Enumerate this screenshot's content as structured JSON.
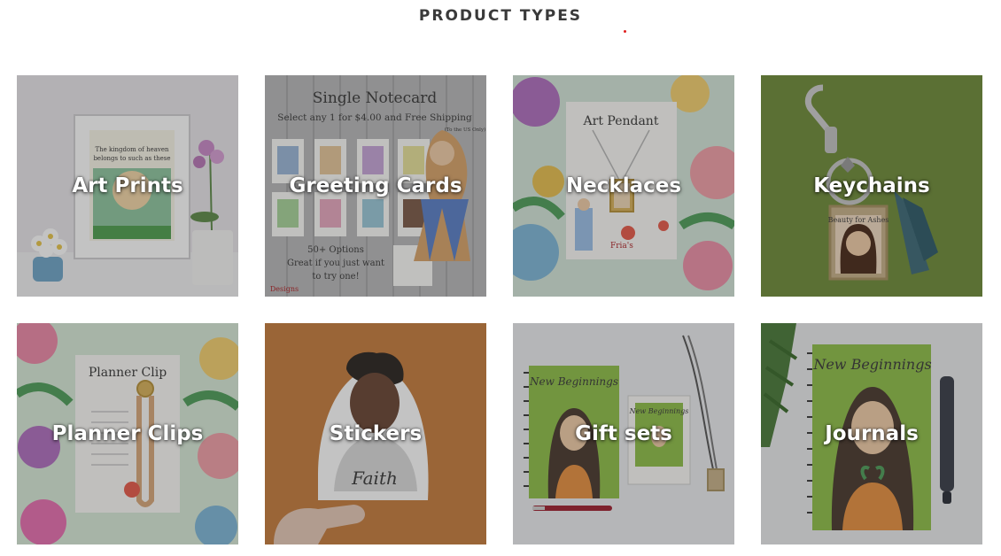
{
  "section": {
    "title": "PRODUCT TYPES"
  },
  "products": [
    {
      "label": "Art Prints",
      "inner": [
        "The kingdom of heaven",
        "belongs to such as these"
      ]
    },
    {
      "label": "Greeting Cards",
      "inner": [
        "Single Notecard",
        "Select any 1 for $4.00 and Free Shipping",
        "(To the US Only)",
        "50+ Options",
        "Great if you just want",
        "to try one!",
        "Designs"
      ]
    },
    {
      "label": "Necklaces",
      "inner": [
        "Art Pendant"
      ]
    },
    {
      "label": "Keychains",
      "inner": [
        "Beauty for Ashes"
      ]
    },
    {
      "label": "Planner Clips",
      "inner": [
        "Planner Clip"
      ]
    },
    {
      "label": "Stickers",
      "inner": [
        "Faith"
      ]
    },
    {
      "label": "Gift sets",
      "inner": [
        "New Beginnings",
        "New Beginnings"
      ]
    },
    {
      "label": "Journals",
      "inner": [
        "New Beginnings"
      ]
    }
  ],
  "colors": {
    "title": "#3a3a3a",
    "accent_dot": "#e02020",
    "overlay": "rgba(40,40,40,0.28)",
    "label": "#ffffff"
  },
  "icons": {
    "accent_dot": "red-dot"
  }
}
